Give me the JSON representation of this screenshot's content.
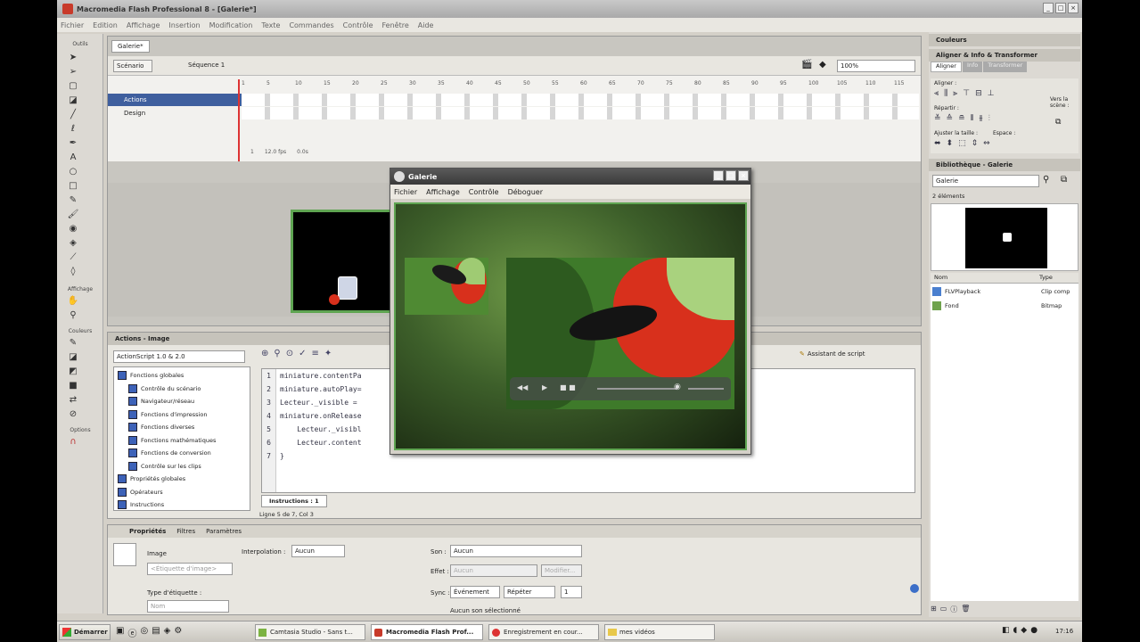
{
  "app": {
    "title": "Macromedia Flash Professional 8 - [Galerie*]",
    "menu": [
      "Fichier",
      "Edition",
      "Affichage",
      "Insertion",
      "Modification",
      "Texte",
      "Commandes",
      "Contrôle",
      "Fenêtre",
      "Aide"
    ]
  },
  "toolbox": {
    "title": "Outils",
    "sections": [
      "Affichage",
      "Couleurs",
      "Options"
    ]
  },
  "document": {
    "tab": "Galerie*",
    "scene_button": "Scénario",
    "scene_name": "Séquence 1",
    "zoom": "100%",
    "layers": [
      {
        "name": "Actions"
      },
      {
        "name": "Design"
      }
    ],
    "ruler": [
      "1",
      "5",
      "10",
      "15",
      "20",
      "25",
      "30",
      "35",
      "40",
      "45",
      "50",
      "55",
      "60",
      "65",
      "70",
      "75",
      "80",
      "85",
      "90",
      "95",
      "100",
      "105",
      "110",
      "115"
    ],
    "fps": "12.0 fps",
    "time": "0.0s",
    "frame": "1"
  },
  "actions": {
    "title": "Actions - Image",
    "version": "ActionScript 1.0 & 2.0",
    "assistant": "Assistant de script",
    "tree": [
      "Fonctions globales",
      "Contrôle du scénario",
      "Navigateur/réseau",
      "Fonctions d'impression",
      "Fonctions diverses",
      "Fonctions mathématiques",
      "Fonctions de conversion",
      "Contrôle sur les clips",
      "Propriétés globales",
      "Opérateurs",
      "Instructions"
    ],
    "code_lines": [
      "miniature.contentPa",
      "miniature.autoPlay=",
      "Lecteur._visible = ",
      "miniature.onRelease",
      "    Lecteur._visibl",
      "    Lecteur.content",
      "}"
    ],
    "line_numbers": [
      "1",
      "2",
      "3",
      "4",
      "5",
      "6",
      "7"
    ],
    "tab_label": "Instructions : 1",
    "status": "Ligne 5 de 7, Col 3"
  },
  "properties": {
    "tabs": [
      "Propriétés",
      "Filtres",
      "Paramètres"
    ],
    "type_label": "Image",
    "label_placeholder": "<Étiquette d'image>",
    "interpolation_label": "Interpolation :",
    "interpolation_value": "Aucun",
    "label_type_label": "Type d'étiquette :",
    "label_type_value": "Nom",
    "sound_label": "Son :",
    "sound_value": "Aucun",
    "effect_label": "Effet :",
    "effect_value": "Aucun",
    "edit_button": "Modifier...",
    "sync_label": "Sync :",
    "sync_value": "Événement",
    "repeat_value": "Répéter",
    "repeat_count": "1",
    "status": "Aucun son sélectionné"
  },
  "right_panel": {
    "colors_header": "Couleurs",
    "align_header": "Aligner & Info & Transformer",
    "align_tabs": [
      "Aligner",
      "Info",
      "Transformer"
    ],
    "align_label": "Aligner :",
    "distribute_label": "Répartir :",
    "match_label": "Ajuster la taille :",
    "space_label": "Espace :",
    "to_stage_label": "Vers la scène :",
    "library_header": "Bibliothèque - Galerie",
    "library_select": "Galerie",
    "element_count": "2 éléments",
    "columns": [
      "Nom",
      "Type"
    ],
    "items": [
      {
        "name": "FLVPlayback",
        "type": "Clip comp"
      },
      {
        "name": "Fond",
        "type": "Bitmap"
      }
    ]
  },
  "player": {
    "title": "Galerie",
    "menu": [
      "Fichier",
      "Affichage",
      "Contrôle",
      "Déboguer"
    ]
  },
  "taskbar": {
    "start": "Démarrer",
    "tasks": [
      "Camtasia Studio - Sans t...",
      "Macromedia Flash Prof...",
      "Enregistrement en cour...",
      "mes vidéos"
    ],
    "clock": "17:16"
  },
  "colors": {
    "accent_green": "#5fa552",
    "flower_red": "#d8301c"
  }
}
